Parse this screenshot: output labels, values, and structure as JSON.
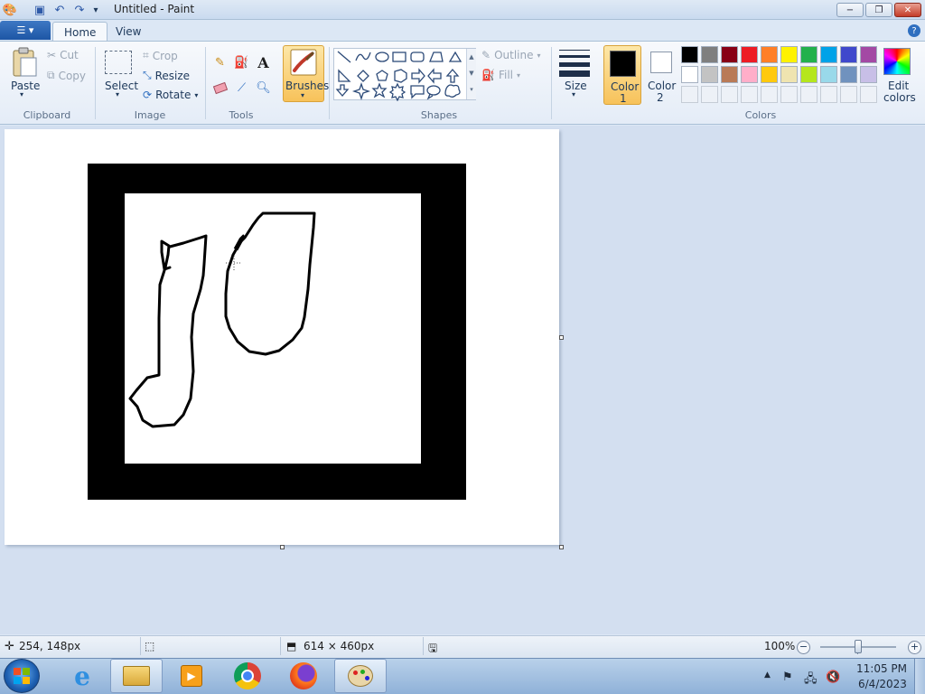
{
  "window": {
    "title": "Untitled - Paint",
    "minimize_glyph": "−",
    "maximize_glyph": "❐",
    "close_glyph": "✕"
  },
  "tabs": [
    {
      "label": "Home",
      "active": true
    },
    {
      "label": "View",
      "active": false
    }
  ],
  "ribbon": {
    "clipboard": {
      "paste": "Paste",
      "cut": "Cut",
      "copy": "Copy",
      "group": "Clipboard"
    },
    "image": {
      "select": "Select",
      "crop": "Crop",
      "resize": "Resize",
      "rotate": "Rotate",
      "group": "Image"
    },
    "tools": {
      "group": "Tools"
    },
    "brushes": {
      "label": "Brushes"
    },
    "shapes": {
      "outline": "Outline",
      "fill": "Fill",
      "group": "Shapes"
    },
    "size": {
      "label": "Size"
    },
    "color1": {
      "line1": "Color",
      "line2": "1"
    },
    "color2": {
      "line1": "Color",
      "line2": "2"
    },
    "colors": {
      "group": "Colors",
      "edit_line1": "Edit",
      "edit_line2": "colors"
    }
  },
  "palette_row1": [
    "#000000",
    "#7f7f7f",
    "#880015",
    "#ed1c24",
    "#ff7f27",
    "#fff200",
    "#22b14c",
    "#00a2e8",
    "#3f48cc",
    "#a349a4"
  ],
  "palette_row2": [
    "#ffffff",
    "#c3c3c3",
    "#b97a57",
    "#ffaec9",
    "#ffc90e",
    "#efe4b0",
    "#b5e61d",
    "#99d9ea",
    "#7092be",
    "#c8bfe7"
  ],
  "status": {
    "cursor_pos": "254, 148px",
    "canvas_size": "614 × 460px",
    "zoom": "100%",
    "zoom_level": 0.5
  },
  "taskbar": {
    "time": "11:05 PM",
    "date": "6/4/2023"
  }
}
